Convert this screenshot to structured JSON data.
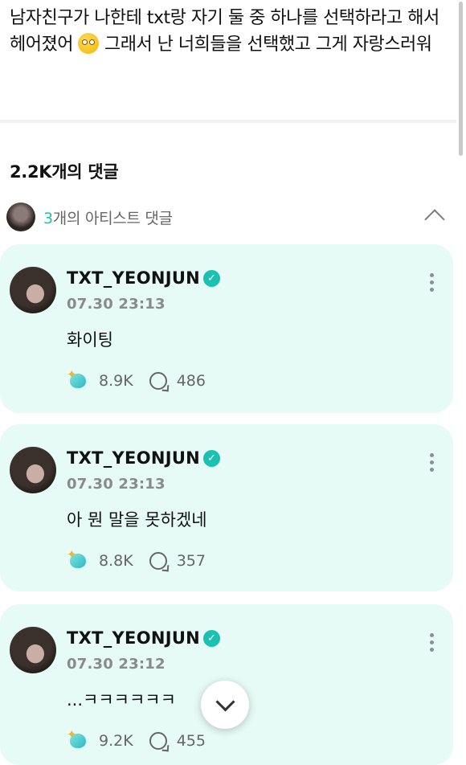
{
  "post": {
    "text_before": "남자친구가 나한테 txt랑 자기 둘 중 하나를 선택하라고 해서 헤어졌어 ",
    "emoji": "face-with-rolling-eyes-emoji",
    "text_after": " 그래서 난 너희들을 선택했고 그게 자랑스러워"
  },
  "comments_header": {
    "count": "2.2K개의 댓글"
  },
  "artist_section": {
    "count": "3",
    "label": "개의 아티스트 댓글",
    "toggle_icon": "chevron-up-icon"
  },
  "comments": [
    {
      "author": "TXT_YEONJUN",
      "time": "07.30 23:13",
      "text": "화이팅",
      "cheers": "8.9K",
      "replies": "486"
    },
    {
      "author": "TXT_YEONJUN",
      "time": "07.30 23:13",
      "text": "아 뭔 말을 못하겠네",
      "cheers": "8.8K",
      "replies": "357"
    },
    {
      "author": "TXT_YEONJUN",
      "time": "07.30 23:12",
      "text": "...ㅋㅋㅋㅋㅋㅋ",
      "cheers": "9.2K",
      "replies": "455"
    }
  ],
  "colors": {
    "accent": "#19c2b0",
    "card_bg": "#e6faf6"
  },
  "scroll_down_icon": "chevron-down-icon"
}
